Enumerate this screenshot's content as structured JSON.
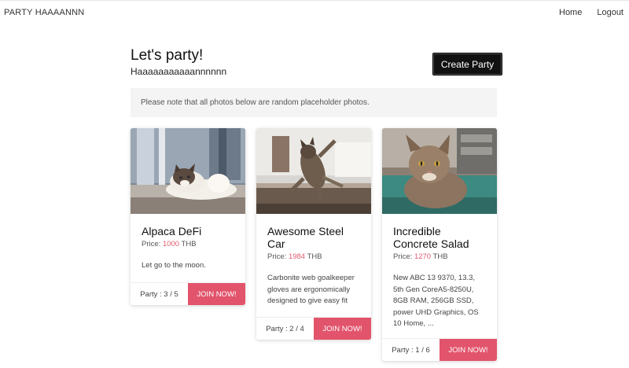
{
  "nav": {
    "brand": "PARTY HAAAANNN",
    "home": "Home",
    "logout": "Logout"
  },
  "header": {
    "title": "Let's party!",
    "subtitle": "Haaaaaaaaaaannnnnn",
    "create_button": "Create Party"
  },
  "notice": "Please note that all photos below are random placeholder photos.",
  "price_prefix": "Price:",
  "currency": "THB",
  "join_label": "JOIN NOW!",
  "accent_color": "#e2546c",
  "cards": [
    {
      "title": "Alpaca DeFi",
      "price": "1000",
      "description": "Let go to the moon.",
      "party": "Party : 3 / 5"
    },
    {
      "title": "Awesome Steel Car",
      "price": "1984",
      "description": "Carbonite web goalkeeper gloves are ergonomically designed to give easy fit",
      "party": "Party : 2 / 4"
    },
    {
      "title": "Incredible Concrete Salad",
      "price": "1270",
      "description": "New ABC 13 9370, 13.3, 5th Gen CoreA5-8250U, 8GB RAM, 256GB SSD, power UHD Graphics, OS 10 Home, ...",
      "party": "Party : 1 / 6"
    }
  ]
}
